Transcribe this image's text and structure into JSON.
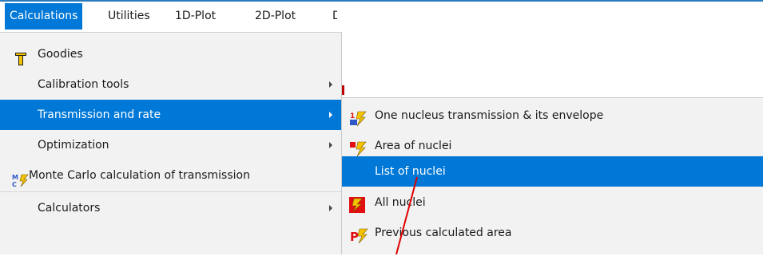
{
  "menubar": {
    "items": [
      {
        "label": "Calculations"
      },
      {
        "label": "Utilities"
      },
      {
        "label": "1D-Plot"
      },
      {
        "label": "2D-Plot"
      },
      {
        "label": "D"
      }
    ]
  },
  "menu": {
    "items": [
      {
        "label": "Goodies",
        "icon": "goodies-icon"
      },
      {
        "label": "Calibration tools",
        "has_submenu": true
      },
      {
        "label": "Transmission and rate",
        "has_submenu": true
      },
      {
        "label": "Optimization",
        "has_submenu": true
      },
      {
        "label": "Monte Carlo calculation of transmission",
        "icon": "monte-carlo-icon"
      },
      {
        "label": "Calculators",
        "has_submenu": true
      }
    ]
  },
  "submenu": {
    "items": [
      {
        "label": "One nucleus transmission & its envelope",
        "icon": "one-nucleus-icon"
      },
      {
        "label": "Area of nuclei",
        "icon": "area-of-nuclei-icon"
      },
      {
        "label": "List of nuclei"
      },
      {
        "label": "All nuclei",
        "icon": "all-nuclei-icon"
      },
      {
        "label": "Previous calculated area",
        "icon": "previous-area-icon"
      }
    ]
  },
  "colors": {
    "highlight": "#0078d7",
    "menu_background": "#f2f2f2",
    "annotation_line": "#e00000",
    "icon_yellow": "#f5c400",
    "icon_red": "#e01010",
    "icon_blue": "#2f57c8"
  }
}
